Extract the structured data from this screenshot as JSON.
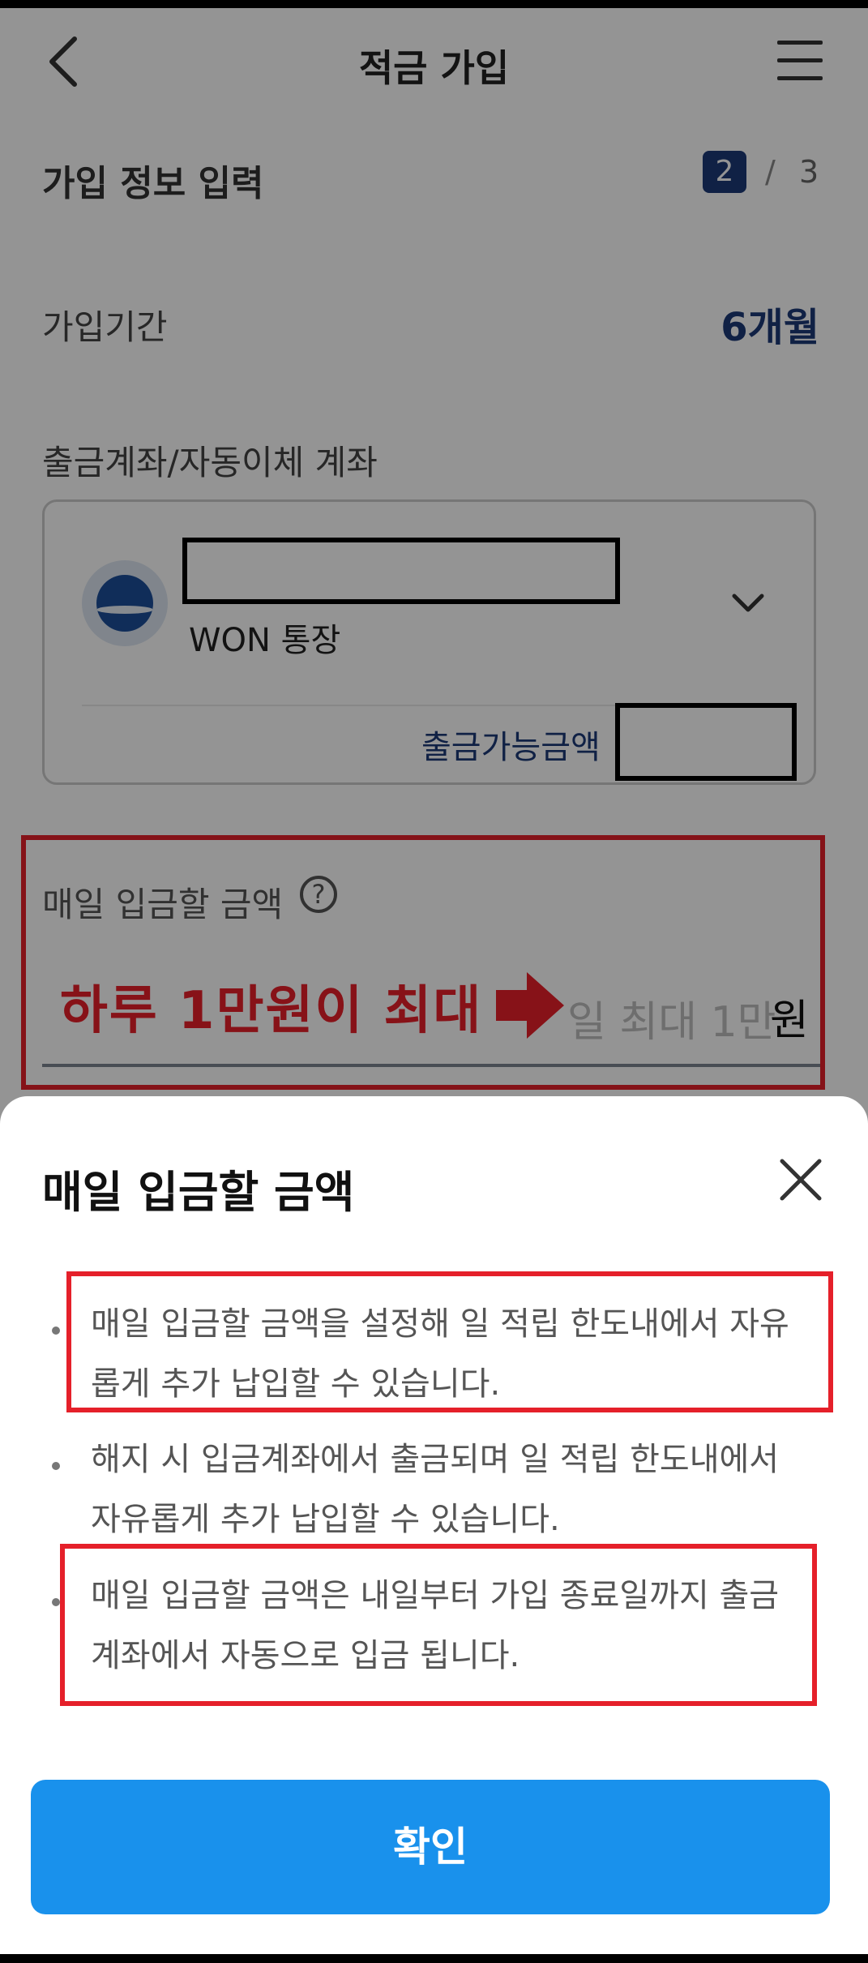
{
  "header": {
    "title": "적금 가입"
  },
  "step": {
    "title": "가입 정보 입력",
    "current": "2",
    "separator": "/",
    "total": "3"
  },
  "period": {
    "label": "가입기간",
    "value": "6개월"
  },
  "account": {
    "label": "출금계좌/자동이체 계좌",
    "name": "WON 통장",
    "available_label": "출금가능금액"
  },
  "daily_amount": {
    "label": "매일 입금할 금액",
    "help": "?",
    "placeholder": "일 최대 1만",
    "unit": "원",
    "annotation": "하루 1만원이 최대"
  },
  "sheet": {
    "title": "매일 입금할 금액",
    "items": [
      {
        "line1": "매일 입금할 금액을 설정해 일 적립 한도내에서 자유",
        "line2": "롭게 추가 납입할 수 있습니다."
      },
      {
        "line1": "해지 시 입금계좌에서 출금되며 일 적립 한도내에서",
        "line2": "자유롭게 추가 납입할 수 있습니다."
      },
      {
        "line1": "매일 입금할 금액은 내일부터 가입 종료일까지 출금",
        "line2": "계좌에서 자동으로 입금 됩니다."
      }
    ],
    "confirm_label": "확인"
  },
  "colors": {
    "accent_blue": "#1991ec",
    "navy": "#1d3a78",
    "annotation_red": "#e5202a"
  }
}
